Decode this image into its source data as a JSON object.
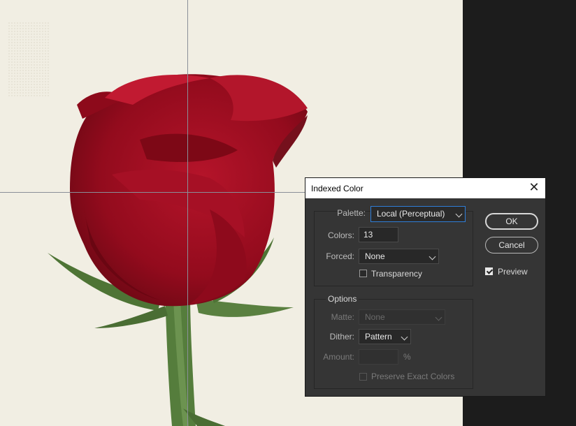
{
  "dialog": {
    "title": "Indexed Color",
    "close_icon": "close-icon",
    "palette": {
      "label": "Palette:",
      "value": "Local (Perceptual)"
    },
    "colors": {
      "label": "Colors:",
      "value": "13"
    },
    "forced": {
      "label": "Forced:",
      "value": "None"
    },
    "transparency": {
      "label": "Transparency",
      "checked": false
    },
    "options": {
      "group_label": "Options",
      "matte": {
        "label": "Matte:",
        "value": "None",
        "enabled": false
      },
      "dither": {
        "label": "Dither:",
        "value": "Pattern"
      },
      "amount": {
        "label": "Amount:",
        "value": "",
        "unit": "%",
        "enabled": false
      },
      "preserve_exact": {
        "label": "Preserve Exact Colors",
        "checked": false,
        "enabled": false
      }
    },
    "buttons": {
      "ok": "OK",
      "cancel": "Cancel"
    },
    "preview": {
      "label": "Preview",
      "checked": true
    }
  },
  "colors": {
    "canvas_bg": "#f1eee3",
    "rose_red": "#9c0d1c",
    "stem_green": "#4f7a3a",
    "dialog_bg": "#353535",
    "focus_blue": "#2f7ed8"
  }
}
